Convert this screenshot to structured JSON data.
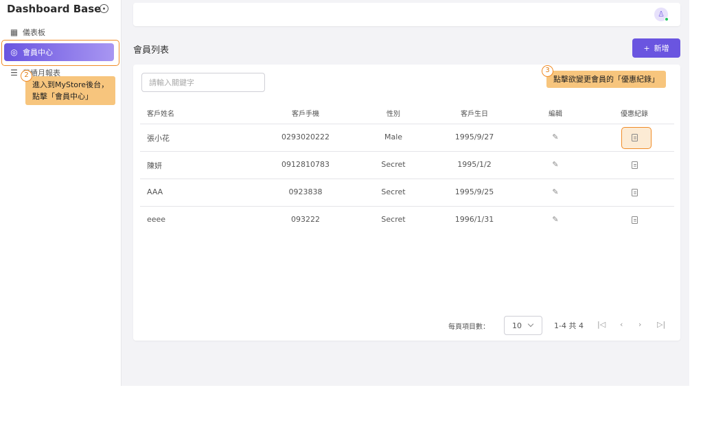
{
  "sidebar": {
    "brand": "Dashboard Base",
    "items": [
      {
        "label": "儀表板",
        "icon": "grid-icon"
      },
      {
        "label": "會員中心",
        "icon": "user-circle-icon"
      },
      {
        "label": "業績月報表",
        "icon": "list-icon"
      }
    ]
  },
  "header": {
    "avatar_icon": "user-icon"
  },
  "page": {
    "title": "會員列表",
    "add_button": "新增",
    "add_icon": "+"
  },
  "search": {
    "placeholder": "請輸入關鍵字"
  },
  "table": {
    "columns": [
      "客戶姓名",
      "客戶手機",
      "性別",
      "客戶生日",
      "編輯",
      "優惠紀錄"
    ],
    "rows": [
      {
        "name": "張小花",
        "phone": "0293020222",
        "gender": "Male",
        "birthday": "1995/9/27"
      },
      {
        "name": "陳妍",
        "phone": "0912810783",
        "gender": "Secret",
        "birthday": "1995/1/2"
      },
      {
        "name": "AAA",
        "phone": "0923838",
        "gender": "Secret",
        "birthday": "1995/9/25"
      },
      {
        "name": "eeee",
        "phone": "093222",
        "gender": "Secret",
        "birthday": "1996/1/31"
      }
    ]
  },
  "pagination": {
    "per_page_label": "每頁項目數：",
    "per_page_value": "10",
    "range": "1-4 共 4",
    "first": "|◁",
    "prev": "‹",
    "next": "›",
    "last": "▷|"
  },
  "annotations": {
    "step2_number": "2",
    "step2_text_line1": "進入到MyStore後台，",
    "step2_text_line2": "點擊「會員中心」",
    "step3_number": "3",
    "step3_text": "點擊欲變更會員的「優惠紀錄」"
  },
  "colors": {
    "accent": "#6a55e0",
    "highlight_border": "#f08a24",
    "tooltip_bg": "#f7c57d"
  }
}
